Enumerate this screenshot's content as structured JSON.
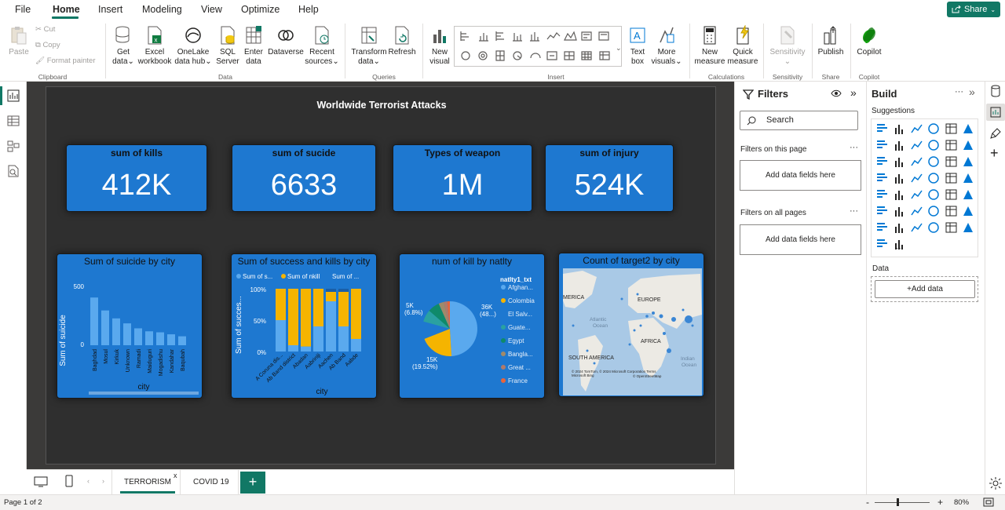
{
  "menu": {
    "file": "File",
    "home": "Home",
    "insert": "Insert",
    "modeling": "Modeling",
    "view": "View",
    "optimize": "Optimize",
    "help": "Help",
    "share": "Share"
  },
  "ribbon": {
    "clipboard": {
      "paste": "Paste",
      "cut": "Cut",
      "copy": "Copy",
      "format_painter": "Format painter",
      "group": "Clipboard"
    },
    "data": {
      "get_data_1": "Get",
      "get_data_2": "data",
      "excel_1": "Excel",
      "excel_2": "workbook",
      "onelake_1": "OneLake",
      "onelake_2": "data hub",
      "sql_1": "SQL",
      "sql_2": "Server",
      "enter_1": "Enter",
      "enter_2": "data",
      "dataverse": "Dataverse",
      "recent_1": "Recent",
      "recent_2": "sources",
      "group": "Data"
    },
    "queries": {
      "transform_1": "Transform",
      "transform_2": "data",
      "refresh": "Refresh",
      "group": "Queries"
    },
    "insert": {
      "new_visual_1": "New",
      "new_visual_2": "visual",
      "text_box_1": "Text",
      "text_box_2": "box",
      "more_visuals_1": "More",
      "more_visuals_2": "visuals",
      "group": "Insert"
    },
    "calculations": {
      "new_measure_1": "New",
      "new_measure_2": "measure",
      "quick_measure_1": "Quick",
      "quick_measure_2": "measure",
      "group": "Calculations"
    },
    "sensitivity": {
      "label": "Sensitivity",
      "group": "Sensitivity"
    },
    "share": {
      "publish": "Publish",
      "group": "Share"
    },
    "copilot": {
      "label": "Copilot",
      "group": "Copilot"
    }
  },
  "report": {
    "title": "Worldwide Terrorist Attacks",
    "cards": [
      {
        "title": "sum of kills",
        "value": "412K"
      },
      {
        "title": "sum of sucide",
        "value": "6633"
      },
      {
        "title": "Types of weapon",
        "value": "1M"
      },
      {
        "title": "sum of injury",
        "value": "524K"
      }
    ],
    "visuals": {
      "suicide": {
        "title": "Sum of suicide by city",
        "ylabel": "Sum of suicide",
        "xlabel": "city",
        "tick_500": "500",
        "tick_0": "0"
      },
      "success": {
        "title": "Sum of success and kills by city",
        "ylabel": "Sum of succes...",
        "xlabel": "city",
        "legend": [
          "Sum of s...",
          "Sum of nkill",
          "Sum of ..."
        ],
        "ticks": [
          "100%",
          "50%",
          "0%"
        ]
      },
      "natlty": {
        "title": "num of kill by natlty",
        "legend_title": "natlty1_txt",
        "labels": [
          "5K",
          "(6.8%)",
          "36K",
          "(48...)",
          "15K",
          "(19.52%)"
        ]
      },
      "map": {
        "title": "Count of target2 by city",
        "labels": [
          "MERICA",
          "EUROPE",
          "Atlantic",
          "Ocean",
          "AFRICA",
          "SOUTH AMERICA",
          "Indian",
          "Ocean"
        ],
        "attribution": "© 2024 TomTom, © 2024 Microsoft Corporation  Terms",
        "attribution2": "© OpenStreetMap",
        "bing": "Microsoft Bing"
      }
    }
  },
  "chart_data": [
    {
      "type": "bar",
      "title": "Sum of suicide by city",
      "xlabel": "city",
      "ylabel": "Sum of suicide",
      "categories": [
        "Baghdad",
        "Mosul",
        "Kirkuk",
        "Unknown",
        "Ramadi",
        "Maiduguri",
        "Mogadishu",
        "Kandahar",
        "Baqubah"
      ],
      "values": [
        480,
        350,
        270,
        220,
        170,
        140,
        130,
        110,
        90
      ],
      "ylim": [
        0,
        600
      ]
    },
    {
      "type": "bar",
      "title": "Sum of success and kills by city",
      "xlabel": "city",
      "ylabel": "Sum of succes...",
      "stacked": "100%",
      "categories": [
        "A Coruna dis...",
        "Ab Band district",
        "Abadan",
        "Aabriniji",
        "Aachen",
        "Ab Band",
        "Aabde"
      ],
      "series": [
        {
          "name": "Sum of s...",
          "values": [
            50,
            10,
            8,
            40,
            80,
            40,
            20
          ]
        },
        {
          "name": "Sum of nkill",
          "values": [
            50,
            90,
            92,
            60,
            15,
            55,
            80
          ]
        },
        {
          "name": "Sum of ...",
          "values": [
            0,
            0,
            0,
            0,
            5,
            5,
            0
          ]
        }
      ],
      "ylim": [
        0,
        100
      ]
    },
    {
      "type": "pie",
      "title": "num of kill by natlty",
      "legend_title": "natlty1_txt",
      "categories": [
        "Afghan...",
        "Colombia",
        "El Salv...",
        "Guate...",
        "Egypt",
        "Bangla...",
        "Great ...",
        "France"
      ],
      "values": [
        48,
        19.52,
        10,
        7,
        6.8,
        3,
        2,
        1.5
      ]
    },
    {
      "type": "map",
      "title": "Count of target2 by city"
    }
  ],
  "filters": {
    "title": "Filters",
    "search": "Search",
    "on_page": "Filters on this page",
    "add_page": "Add data fields here",
    "all_pages": "Filters on all pages",
    "add_all": "Add data fields here"
  },
  "build": {
    "title": "Build",
    "suggestions": "Suggestions",
    "data": "Data",
    "add_data": "+Add data",
    "more": "···"
  },
  "tabs": {
    "t1": "TERRORISM",
    "t2": "COVID 19",
    "close": "x",
    "add": "+"
  },
  "status": {
    "page": "Page 1 of 2",
    "zoom": "80%",
    "minus": "-",
    "plus": "+"
  },
  "colors": {
    "accent": "#117865",
    "card_blue": "#1e78d0",
    "gold": "#f5b400",
    "canvas": "#3b3a39"
  }
}
